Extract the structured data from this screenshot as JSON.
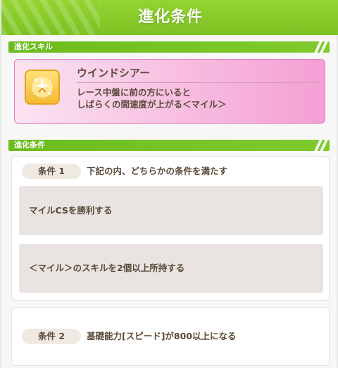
{
  "header": {
    "title": "進化条件"
  },
  "skill_section": {
    "label": "進化スキル"
  },
  "skill": {
    "icon": "sparkle-runner-icon",
    "name": "ウインドシアー",
    "description_line1": "レース中盤に前の方にいると",
    "description_line2": "しばらくの間速度が上がる＜マイル＞"
  },
  "conditions_section": {
    "label": "進化条件"
  },
  "conditions": [
    {
      "tag": "条件 1",
      "title": "下記の内、どちらかの条件を満たす",
      "requirements": [
        "マイルCSを勝利する",
        "＜マイル＞のスキルを2個以上所持する"
      ]
    },
    {
      "tag": "条件 2",
      "title": "基礎能力[スピード]が800以上になる"
    }
  ],
  "colors": {
    "header_green": "#7cc222",
    "skill_pink": "#f7bde0",
    "text_brown": "#5b4a3a"
  }
}
